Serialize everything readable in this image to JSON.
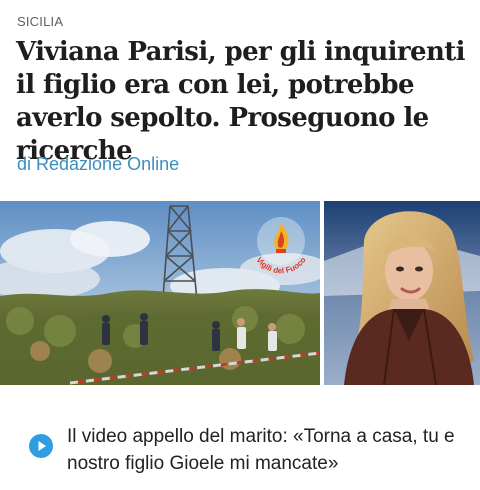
{
  "article": {
    "section": "SICILIA",
    "title": "Viviana Parisi, per gli inquirenti il figlio era con lei, potrebbe averlo sepolto. Proseguono le ricerche",
    "byline": "di Redazione Online"
  },
  "photo": {
    "watermark": "Vigili del Fuoco"
  },
  "related": {
    "video_title": "Il video appello del marito: «Torna a casa, tu e nostro figlio Gioele mi mancate»",
    "icon": "play-icon"
  },
  "colors": {
    "byline": "#3a8fbf",
    "play_button": "#2e9ee0",
    "headline": "#1e1e1e"
  }
}
